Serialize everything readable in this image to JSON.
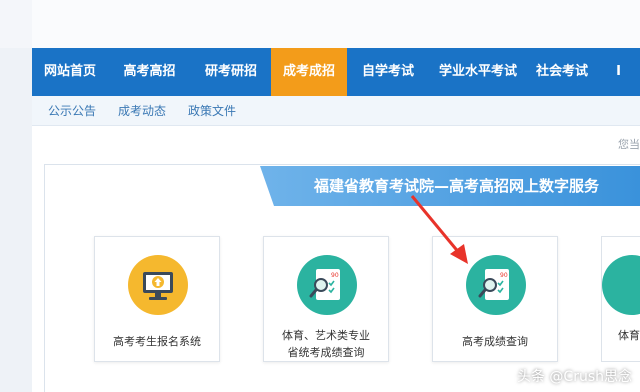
{
  "nav": {
    "items": [
      {
        "label": "网站首页"
      },
      {
        "label": "高考高招"
      },
      {
        "label": "研考研招"
      },
      {
        "label": "成考成招",
        "active": true
      },
      {
        "label": "自学考试"
      },
      {
        "label": "学业水平考试"
      },
      {
        "label": "社会考试"
      },
      {
        "label": "I"
      }
    ]
  },
  "subnav": {
    "items": [
      {
        "label": "公示公告"
      },
      {
        "label": "成考动态"
      },
      {
        "label": "政策文件"
      }
    ]
  },
  "breadcrumb": "您当",
  "banner": {
    "title": "福建省教育考试院—高考高招网上数字服务"
  },
  "cards": [
    {
      "label": "高考考生报名系统",
      "icon": "monitor-upload-icon",
      "icon_color": "#f5b82e"
    },
    {
      "label_line1": "体育、艺术类专业",
      "label_line2": "省统考成绩查询",
      "icon": "score-report-icon",
      "icon_color": "#2bb3a0"
    },
    {
      "label": "高考成绩查询",
      "icon": "score-report-icon",
      "icon_color": "#2bb3a0"
    },
    {
      "label": "体育",
      "icon": "score-report-icon",
      "icon_color": "#2bb3a0"
    }
  ],
  "watermark": "头条 @Crush思念",
  "colors": {
    "nav_bg": "#1a73c6",
    "nav_active": "#f39c1a",
    "banner": "#3a92db",
    "arrow": "#e8332a"
  }
}
